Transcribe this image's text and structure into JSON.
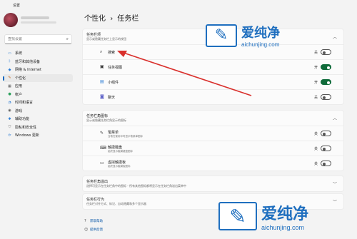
{
  "window": {
    "app_title": "设置"
  },
  "search": {
    "placeholder": "查找设置",
    "icon": "search-icon"
  },
  "sidebar": {
    "items": [
      {
        "label": "系统",
        "icon": "monitor-icon",
        "active": false
      },
      {
        "label": "蓝牙和其他设备",
        "icon": "bluetooth-icon",
        "active": false
      },
      {
        "label": "网络 & Internet",
        "icon": "wifi-icon",
        "active": false
      },
      {
        "label": "个性化",
        "icon": "brush-icon",
        "active": true
      },
      {
        "label": "应用",
        "icon": "apps-icon",
        "active": false
      },
      {
        "label": "帐户",
        "icon": "person-icon",
        "active": false
      },
      {
        "label": "时间和语言",
        "icon": "globe-clock-icon",
        "active": false
      },
      {
        "label": "游戏",
        "icon": "gamepad-icon",
        "active": false
      },
      {
        "label": "辅助功能",
        "icon": "accessibility-icon",
        "active": false
      },
      {
        "label": "隐私和安全性",
        "icon": "shield-icon",
        "active": false
      },
      {
        "label": "Windows 更新",
        "icon": "update-icon",
        "active": false
      }
    ]
  },
  "header": {
    "breadcrumb_parent": "个性化",
    "separator": "›",
    "breadcrumb_current": "任务栏"
  },
  "taskbar_items": {
    "title": "任务栏项",
    "subtitle": "显示或隐藏任务栏上显示的按钮",
    "rows": [
      {
        "label": "搜索",
        "icon": "search-icon",
        "state_text": "关",
        "on": false
      },
      {
        "label": "任务视图",
        "icon": "taskview-icon",
        "state_text": "开",
        "on": true
      },
      {
        "label": "小组件",
        "icon": "widgets-icon",
        "state_text": "开",
        "on": true
      },
      {
        "label": "聊天",
        "icon": "chat-icon",
        "state_text": "关",
        "on": false
      }
    ]
  },
  "corner_icons": {
    "title": "任务栏角图标",
    "subtitle": "显示或隐藏任务栏角显示的图标",
    "rows": [
      {
        "label": "笔菜单",
        "sub": "当笔在使用中时显示笔菜单图标",
        "icon": "pen-icon",
        "state_text": "关",
        "on": false
      },
      {
        "label": "触摸键盘",
        "sub": "始终显示触摸键盘图标",
        "icon": "keyboard-icon",
        "state_text": "关",
        "on": false
      },
      {
        "label": "虚拟触摸板",
        "sub": "始终显示触摸板图标",
        "icon": "touchpad-icon",
        "state_text": "关",
        "on": false
      }
    ]
  },
  "overflow": {
    "title": "任务栏角溢出",
    "subtitle": "选择可显示在任务栏角中的图标 - 所有其他图标都将显示在任务栏角溢出菜单中"
  },
  "behaviors": {
    "title": "任务栏行为",
    "subtitle": "任务栏对齐方式、标记、自动隐藏和多个显示器"
  },
  "footer": {
    "help": "获取帮助",
    "feedback": "提供反馈"
  },
  "watermark": {
    "brand": "爱纯净",
    "url": "aichunjing.com"
  },
  "colors": {
    "accent": "#0067c0",
    "toggle_on": "#0f6b3a",
    "arrow": "#d9302c",
    "watermark": "#1f6fbf"
  }
}
